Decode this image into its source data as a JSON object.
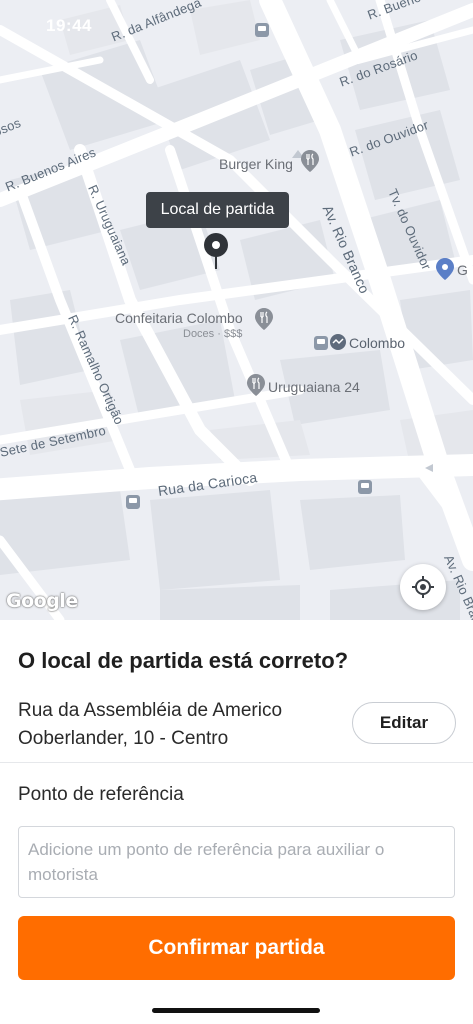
{
  "status_bar": {
    "time": "19:44"
  },
  "map": {
    "streets": [
      {
        "label": "R. da Alfândega"
      },
      {
        "label": "R. Buenos"
      },
      {
        "label": "R. do Rosário"
      },
      {
        "label": "R. do Ouvidor"
      },
      {
        "label": "osos"
      },
      {
        "label": "R. Buenos Aires"
      },
      {
        "label": "R. Uruguaiana"
      },
      {
        "label": "Av. Rio Branco"
      },
      {
        "label": "Tv. do Ouvidor"
      },
      {
        "label": "R. Ramalho Ortigão"
      },
      {
        "label": "Sete de Setembro"
      },
      {
        "label": "Rua da Carioca"
      },
      {
        "label": "Av. Rio Branco"
      }
    ],
    "pois": {
      "burger_king": "Burger King",
      "confeitaria": "Confeitaria Colombo",
      "confeitaria_sub": "Doces · $$$",
      "colombo": "Colombo",
      "uruguaiana24": "Uruguaiana 24",
      "edge_g": "G"
    },
    "tooltip": "Local de partida",
    "attribution": "Google",
    "icons": {
      "locate": "crosshair-icon",
      "restaurant": "fork-knife-icon",
      "bus": "bus-stop-icon"
    }
  },
  "sheet": {
    "question": "O local de partida está correto?",
    "address_line1": "Rua da Assembléia de Americo",
    "address_line2": "Ooberlander, 10 - Centro",
    "edit_label": "Editar",
    "ref_label": "Ponto de referência",
    "ref_placeholder": "Adicione um ponto de referência para auxiliar o motorista",
    "ref_value": "",
    "confirm_label": "Confirmar partida"
  },
  "colors": {
    "accent": "#ff6d00",
    "map_background": "#eceef3",
    "tooltip_background": "#3d4248"
  }
}
